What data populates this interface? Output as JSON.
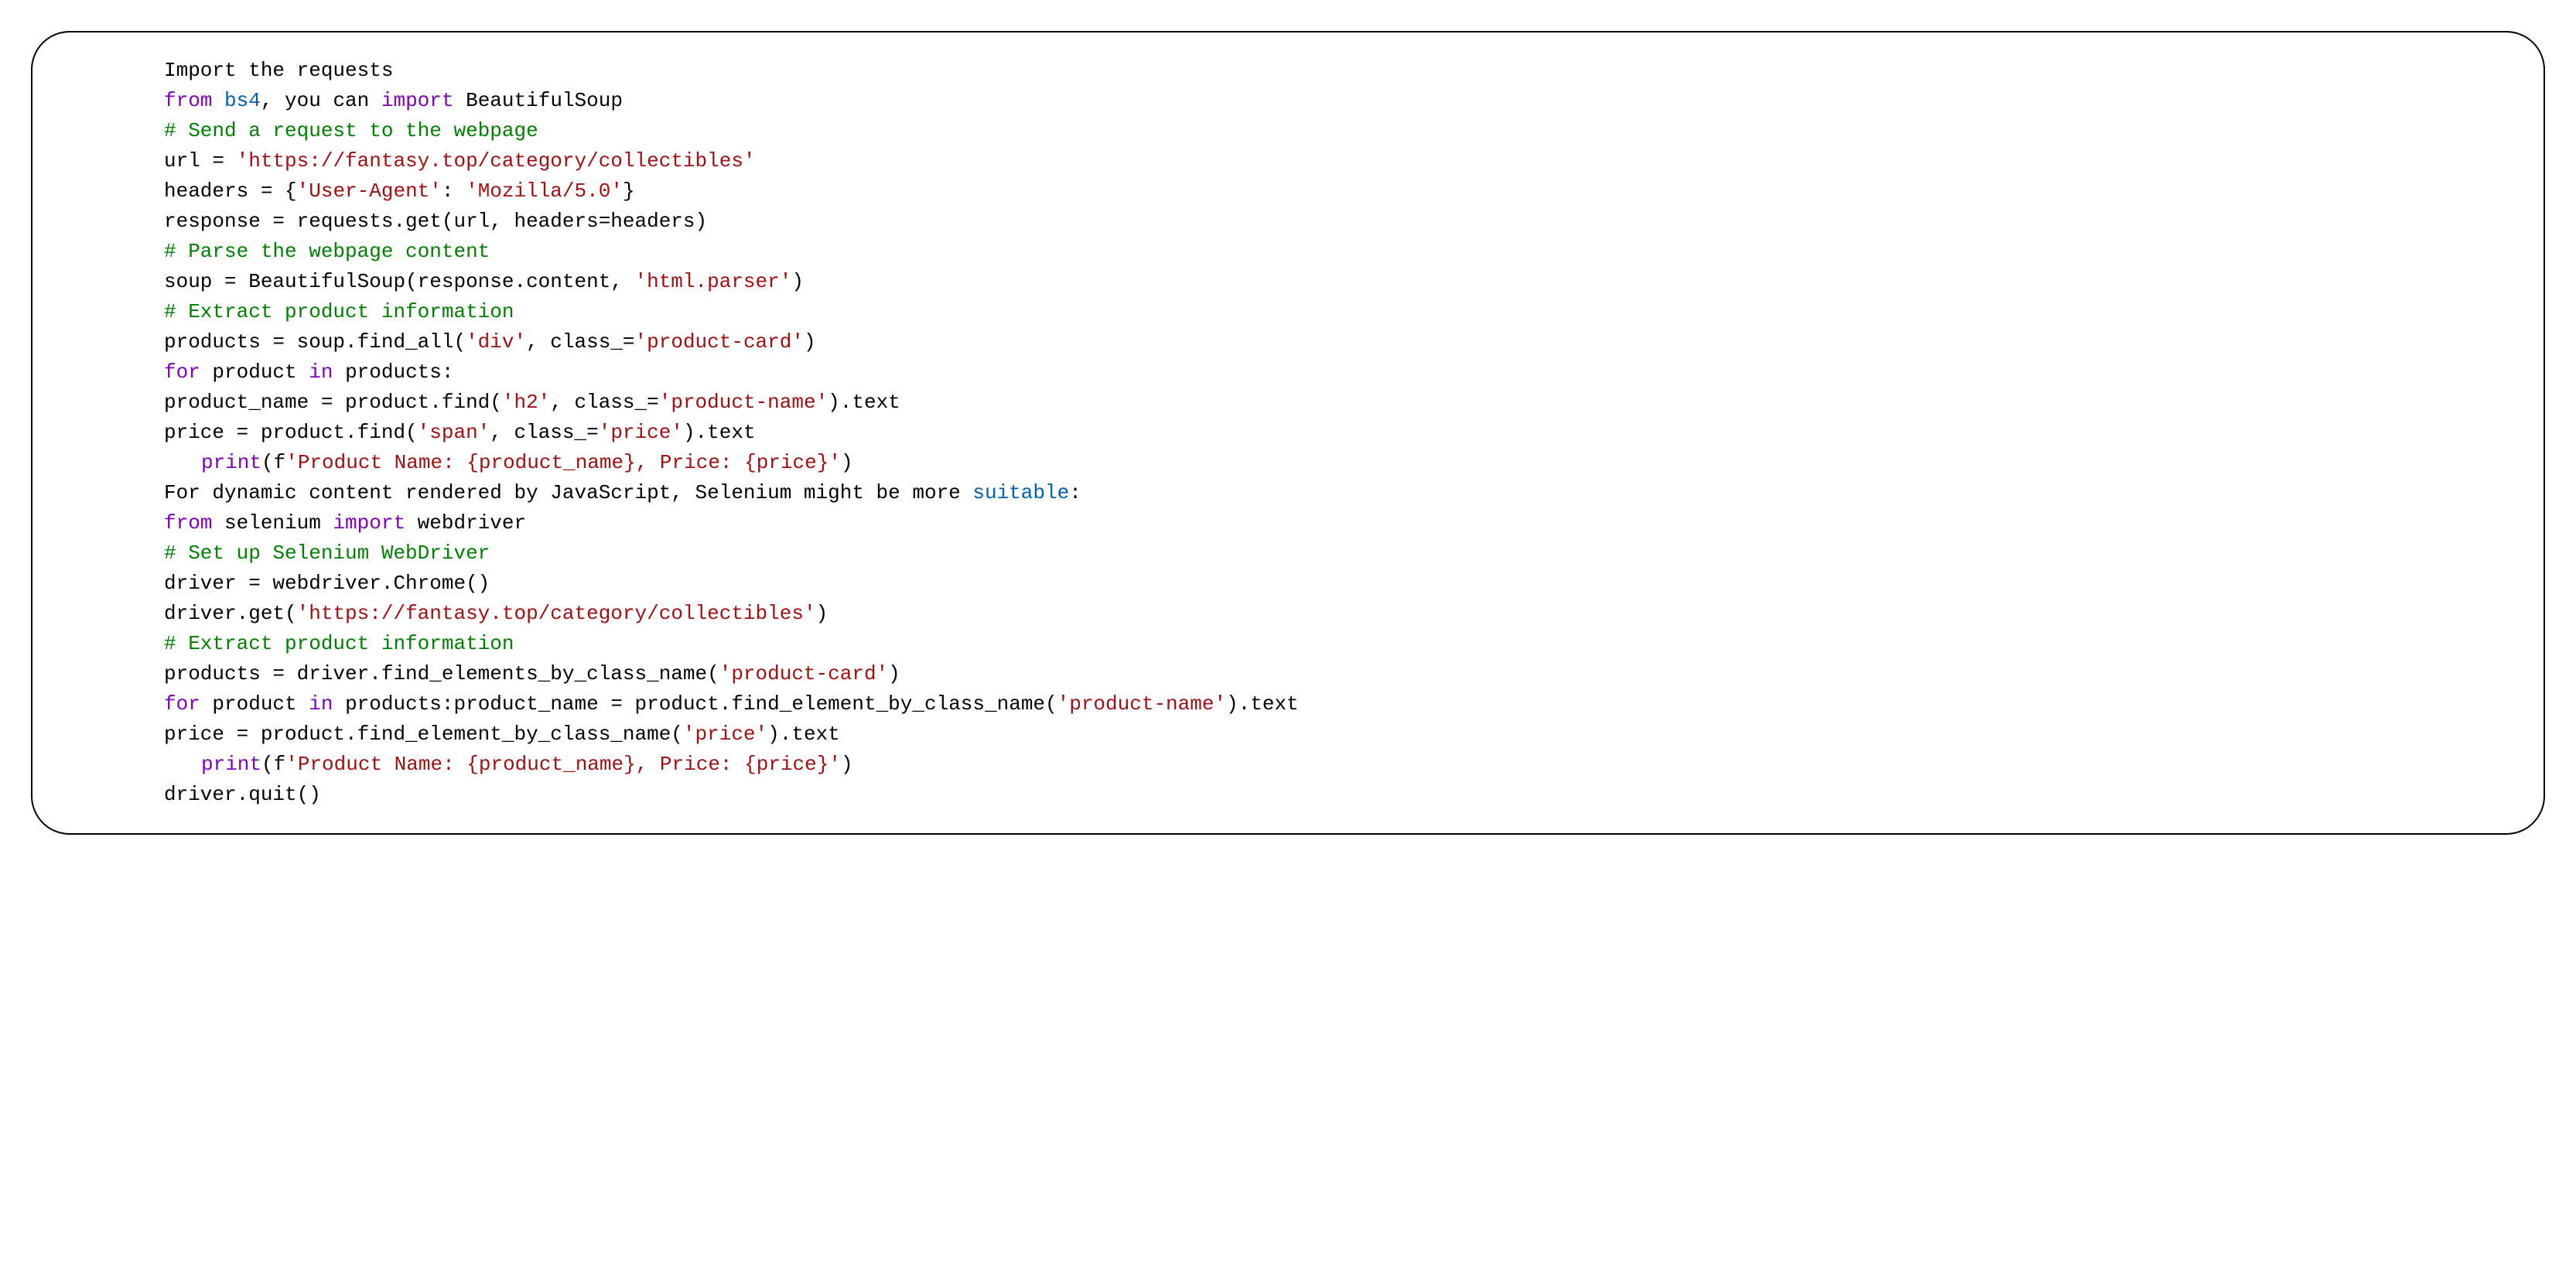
{
  "code": {
    "l01_a": "Import the requests",
    "l02_a": "from",
    "l02_b": " bs4",
    "l02_c": ", you can ",
    "l02_d": "import",
    "l02_e": " BeautifulSoup",
    "l03_a": "# Send a request to the webpage",
    "l04_a": "url = ",
    "l04_b": "'https://fantasy.top/category/collectibles'",
    "l05_a": "headers = {",
    "l05_b": "'User-Agent'",
    "l05_c": ": ",
    "l05_d": "'Mozilla/5.0'",
    "l05_e": "}",
    "l06_a": "response = requests.get(url, headers=headers)",
    "l07_a": "# Parse the webpage content",
    "l08_a": "soup = BeautifulSoup(response.content, ",
    "l08_b": "'html.parser'",
    "l08_c": ")",
    "l09_a": "# Extract product information",
    "l10_a": "products = soup.find_all(",
    "l10_b": "'div'",
    "l10_c": ", class_=",
    "l10_d": "'product-card'",
    "l10_e": ")",
    "l11_a": "for",
    "l11_b": " product ",
    "l11_c": "in",
    "l11_d": " products:",
    "l12_a": "product_name = product.find(",
    "l12_b": "'h2'",
    "l12_c": ", class_=",
    "l12_d": "'product-name'",
    "l12_e": ").text",
    "l13_a": "price = product.find(",
    "l13_b": "'span'",
    "l13_c": ", class_=",
    "l13_d": "'price'",
    "l13_e": ").text",
    "l14_a": "print",
    "l14_b": "(f",
    "l14_c": "'Product Name: {product_name}, Price: {price}'",
    "l14_d": ")",
    "l15_a": "For dynamic content rendered by JavaScript, Selenium might be more ",
    "l15_b": "suitable",
    "l15_c": ":",
    "l16_a": "from",
    "l16_b": " selenium ",
    "l16_c": "import",
    "l16_d": " webdriver",
    "l17_a": "# Set up Selenium WebDriver",
    "l18_a": "driver = webdriver.Chrome()",
    "l19_a": "driver.get(",
    "l19_b": "'https://fantasy.top/category/collectibles'",
    "l19_c": ")",
    "l20_a": "# Extract product information",
    "l21_a": "products = driver.find_elements_by_class_name(",
    "l21_b": "'product-card'",
    "l21_c": ")",
    "l22_a": "for",
    "l22_b": " product ",
    "l22_c": "in",
    "l22_d": " products:product_name = product.find_element_by_class_name(",
    "l22_e": "'product-name'",
    "l22_f": ").text",
    "l23_a": "price = product.find_element_by_class_name(",
    "l23_b": "'price'",
    "l23_c": ").text",
    "l24_a": "print",
    "l24_b": "(f",
    "l24_c": "'Product Name: {product_name}, Price: {price}'",
    "l24_d": ")",
    "l25_a": "driver.quit()"
  }
}
